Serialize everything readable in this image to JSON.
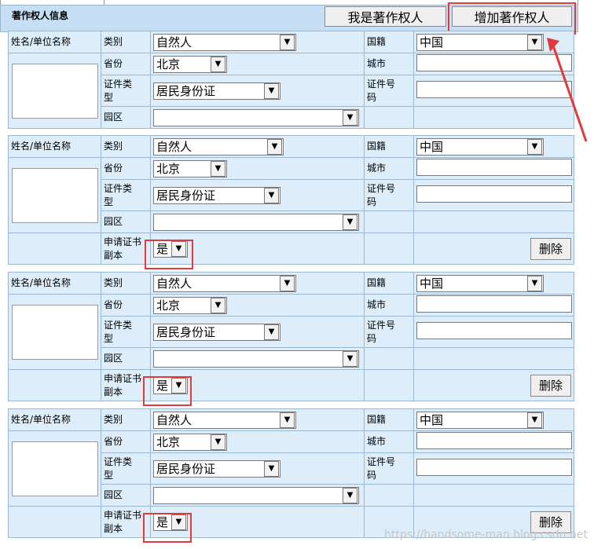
{
  "header": {
    "title": "著作权人信息",
    "btn_me": "我是著作权人",
    "btn_add": "增加著作权人"
  },
  "labels": {
    "name": "姓名/单位名称",
    "type": "类别",
    "nationality": "国籍",
    "province": "省份",
    "city": "城市",
    "id_type_1": "证件类",
    "id_type_2": "型",
    "id_no_1": "证件号",
    "id_no_2": "码",
    "park": "园区",
    "copy_1": "申请证书",
    "copy_2": "副本"
  },
  "values": {
    "type": "自然人",
    "nationality": "中国",
    "province": "北京",
    "id_type": "居民身份证",
    "copy": "是",
    "delete": "删除"
  },
  "watermark": "https://handsome-man.blog.csdn.net",
  "icons": {
    "dropdown": "chevron-down-icon",
    "arrow": "red-arrow-annotation"
  },
  "accent": "#e23a3a"
}
